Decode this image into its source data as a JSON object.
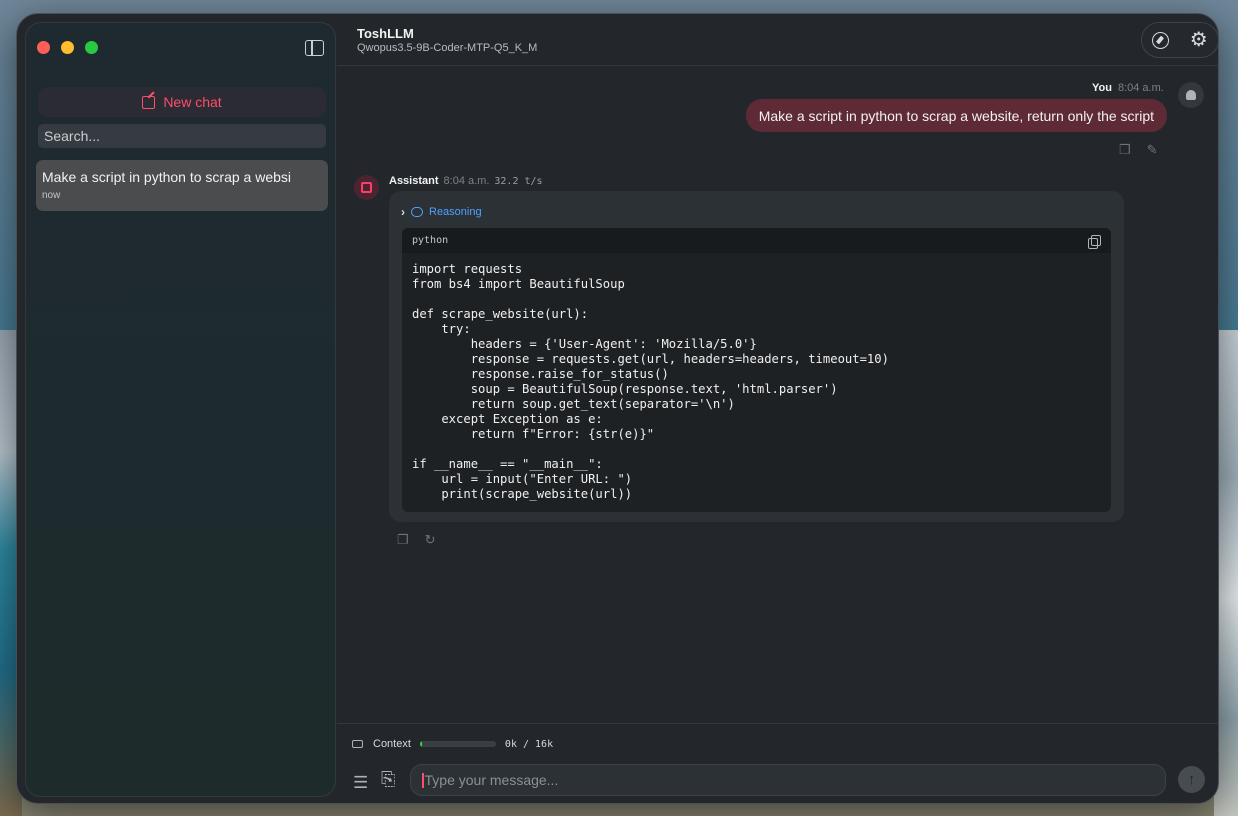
{
  "window": {
    "app_title": "ToshLLM",
    "model": "Qwopus3.5-9B-Coder-MTP-Q5_K_M"
  },
  "sidebar": {
    "new_chat_label": "New chat",
    "search_placeholder": "Search...",
    "chats": [
      {
        "title": "Make a script in python to scrap a websi",
        "time": "now"
      }
    ]
  },
  "conversation": {
    "user": {
      "name": "You",
      "time": "8:04 a.m.",
      "text": "Make a script in python to scrap a website, return only the script"
    },
    "assistant": {
      "name": "Assistant",
      "time": "8:04 a.m.",
      "speed": "32.2 t/s",
      "reasoning_label": "Reasoning",
      "code_language": "python",
      "code": "import requests\nfrom bs4 import BeautifulSoup\n\ndef scrape_website(url):\n    try:\n        headers = {'User-Agent': 'Mozilla/5.0'}\n        response = requests.get(url, headers=headers, timeout=10)\n        response.raise_for_status()\n        soup = BeautifulSoup(response.text, 'html.parser')\n        return soup.get_text(separator='\\n')\n    except Exception as e:\n        return f\"Error: {str(e)}\"\n\nif __name__ == \"__main__\":\n    url = input(\"Enter URL: \")\n    print(scrape_website(url))"
    }
  },
  "footer": {
    "context_label": "Context",
    "context_value": "0k / 16k",
    "context_fraction": 0.03,
    "input_placeholder": "Type your message..."
  },
  "colors": {
    "accent": "#ff4d6d",
    "user_bubble": "#5e2a36",
    "link": "#4da3ff",
    "context_fill": "#3fd24a"
  }
}
